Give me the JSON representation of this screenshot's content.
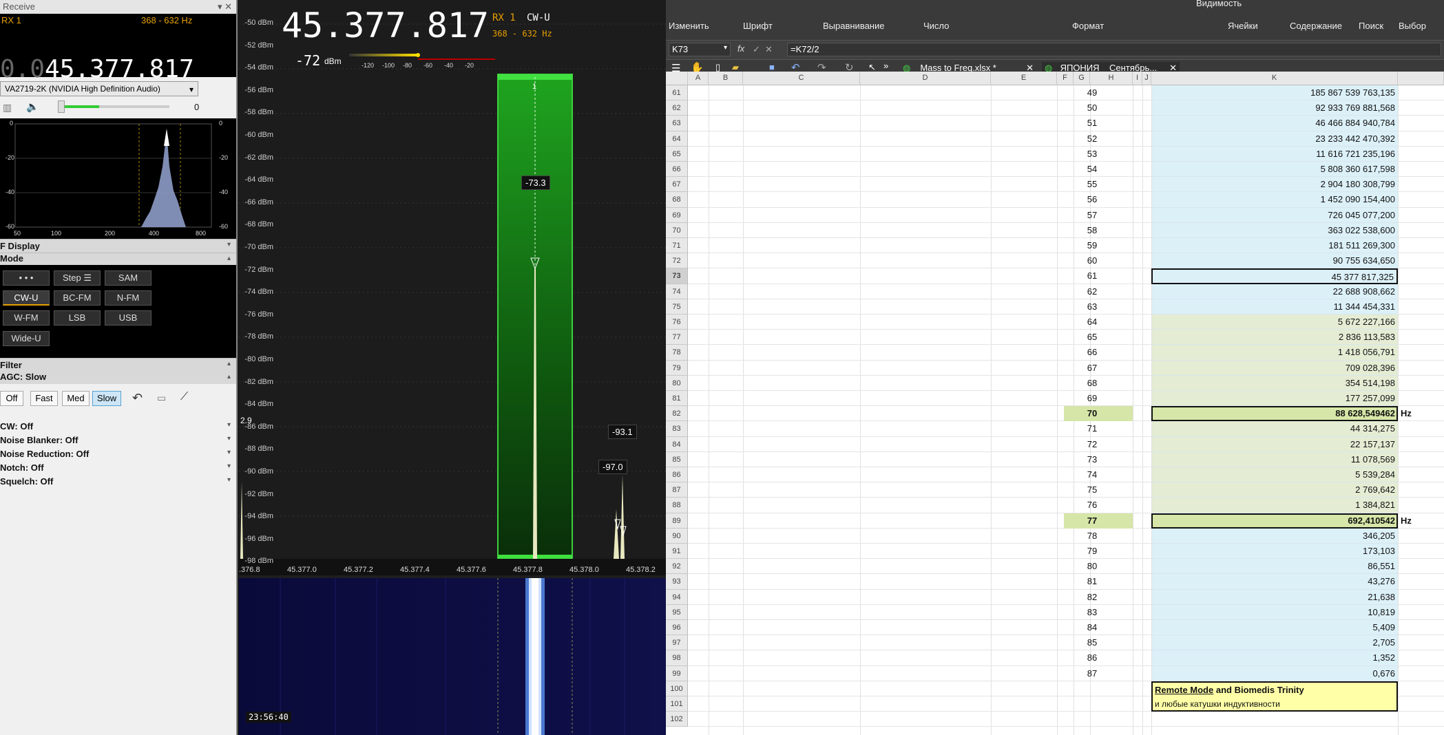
{
  "receive": {
    "title": "Receive",
    "rx": "RX 1",
    "bandwidth": "368 - 632 Hz",
    "freq_dim": "0.0",
    "freq": "45.377.817",
    "device": "VA2719-2K (NVIDIA High Definition Audio)",
    "volume": "0",
    "spec_y_left": [
      "0",
      "-20",
      "-40",
      "-60"
    ],
    "spec_y_right": [
      "0",
      "-20",
      "-40",
      "-60"
    ],
    "spec_x": [
      "50",
      "100",
      "200",
      "400",
      "800"
    ]
  },
  "sections": {
    "if_display": "F Display",
    "mode": "Mode",
    "filter": "Filter",
    "agc": "AGC: Slow"
  },
  "modes": [
    "• • •",
    "Step ☰",
    "SAM",
    "CW-U",
    "BC-FM",
    "N-FM",
    "W-FM",
    "LSB",
    "USB",
    "Wide-U"
  ],
  "agc_buttons": [
    "Off",
    "Fast",
    "Med",
    "Slow"
  ],
  "options": [
    "CW: Off",
    "Noise Blanker: Off",
    "Noise Reduction: Off",
    "Notch: Off",
    "Squelch: Off"
  ],
  "main": {
    "freq": "45.377.817",
    "rx": "RX 1",
    "mode": "CW-U",
    "bw": "368 - 632 Hz",
    "level": "-72",
    "level_unit": "dBm",
    "meter_ticks": [
      "-120",
      "-100",
      "-80",
      "-60",
      "-40",
      "-20"
    ],
    "db_labels": [
      "-50 dBm",
      "-52 dBm",
      "-54 dBm",
      "-56 dBm",
      "-58 dBm",
      "-60 dBm",
      "-62 dBm",
      "-64 dBm",
      "-66 dBm",
      "-68 dBm",
      "-70 dBm",
      "-72 dBm",
      "-74 dBm",
      "-76 dBm",
      "-78 dBm",
      "-80 dBm",
      "-82 dBm",
      "-84 dBm",
      "-86 dBm",
      "-88 dBm",
      "-90 dBm",
      "-92 dBm",
      "-94 dBm",
      "-96 dBm",
      "-98 dBm"
    ],
    "x_ticks": [
      ".376.8",
      "45.377.0",
      "45.377.2",
      "45.377.4",
      "45.377.6",
      "45.377.8",
      "45.378.0",
      "45.378.2"
    ],
    "channel": "1",
    "peak1": "-73.3",
    "peak2": "-93.1",
    "peak3": "-97.0",
    "edge_val": "2.9",
    "time": "23:56:40"
  },
  "excel": {
    "ribbon_groups": [
      "Изменить",
      "Шрифт",
      "Выравнивание",
      "Число",
      "Формат",
      "Ячейки",
      "Содержание",
      "Поиск",
      "Выбор"
    ],
    "top_partial": "Видимость",
    "cell_ref": "K73",
    "formula": "=K72/2",
    "tabs": [
      "Mass to Freq.xlsx *",
      "_ЯПОНИЯ__Сентябрь..."
    ],
    "columns": [
      "A",
      "B",
      "C",
      "D",
      "E",
      "F",
      "G",
      "H",
      "I",
      "J",
      "K"
    ],
    "rows": [
      {
        "r": "61",
        "h": "49",
        "k": "185 867 539 763,135"
      },
      {
        "r": "62",
        "h": "50",
        "k": "92 933 769 881,568"
      },
      {
        "r": "63",
        "h": "51",
        "k": "46 466 884 940,784"
      },
      {
        "r": "64",
        "h": "52",
        "k": "23 233 442 470,392"
      },
      {
        "r": "65",
        "h": "53",
        "k": "11 616 721 235,196"
      },
      {
        "r": "66",
        "h": "54",
        "k": "5 808 360 617,598"
      },
      {
        "r": "67",
        "h": "55",
        "k": "2 904 180 308,799"
      },
      {
        "r": "68",
        "h": "56",
        "k": "1 452 090 154,400"
      },
      {
        "r": "69",
        "h": "57",
        "k": "726 045 077,200"
      },
      {
        "r": "70",
        "h": "58",
        "k": "363 022 538,600"
      },
      {
        "r": "71",
        "h": "59",
        "k": "181 511 269,300"
      },
      {
        "r": "72",
        "h": "60",
        "k": "90 755 634,650"
      },
      {
        "r": "73",
        "h": "61",
        "k": "45 377 817,325"
      },
      {
        "r": "74",
        "h": "62",
        "k": "22 688 908,662"
      },
      {
        "r": "75",
        "h": "63",
        "k": "11 344 454,331"
      },
      {
        "r": "76",
        "h": "64",
        "k": "5 672 227,166"
      },
      {
        "r": "77",
        "h": "65",
        "k": "2 836 113,583"
      },
      {
        "r": "78",
        "h": "66",
        "k": "1 418 056,791"
      },
      {
        "r": "79",
        "h": "67",
        "k": "709 028,396"
      },
      {
        "r": "80",
        "h": "68",
        "k": "354 514,198"
      },
      {
        "r": "81",
        "h": "69",
        "k": "177 257,099"
      },
      {
        "r": "82",
        "h": "70",
        "k": "88 628,549462",
        "unit": "Hz",
        "bold": true
      },
      {
        "r": "83",
        "h": "71",
        "k": "44 314,275"
      },
      {
        "r": "84",
        "h": "72",
        "k": "22 157,137"
      },
      {
        "r": "85",
        "h": "73",
        "k": "11 078,569"
      },
      {
        "r": "86",
        "h": "74",
        "k": "5 539,284"
      },
      {
        "r": "87",
        "h": "75",
        "k": "2 769,642"
      },
      {
        "r": "88",
        "h": "76",
        "k": "1 384,821"
      },
      {
        "r": "89",
        "h": "77",
        "k": "692,410542",
        "unit": "Hz",
        "bold": true
      },
      {
        "r": "90",
        "h": "78",
        "k": "346,205"
      },
      {
        "r": "91",
        "h": "79",
        "k": "173,103"
      },
      {
        "r": "92",
        "h": "80",
        "k": "86,551"
      },
      {
        "r": "93",
        "h": "81",
        "k": "43,276"
      },
      {
        "r": "94",
        "h": "82",
        "k": "21,638"
      },
      {
        "r": "95",
        "h": "83",
        "k": "10,819"
      },
      {
        "r": "96",
        "h": "84",
        "k": "5,409"
      },
      {
        "r": "97",
        "h": "85",
        "k": "2,705"
      },
      {
        "r": "98",
        "h": "86",
        "k": "1,352"
      },
      {
        "r": "99",
        "h": "87",
        "k": "0,676"
      },
      {
        "r": "100",
        "h": "",
        "k": ""
      },
      {
        "r": "101",
        "h": "",
        "k": ""
      },
      {
        "r": "102",
        "h": "",
        "k": ""
      }
    ],
    "note_line1_a": "Remote Mode",
    "note_line1_b": " and Biomedis Trinity",
    "note_line2": "и любые катушки индуктивности",
    "colors": {
      "blue_fill": "#dcf0f8",
      "green_fill": "#e4ecd4",
      "yellow_fill": "#ffffa8",
      "highlight": "#d6e6a8"
    }
  }
}
